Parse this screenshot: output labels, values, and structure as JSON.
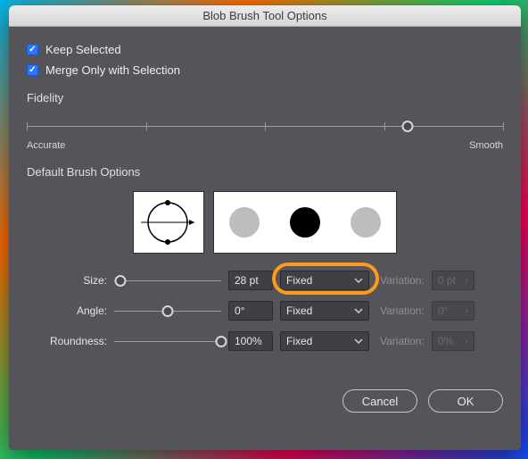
{
  "window": {
    "title": "Blob Brush Tool Options"
  },
  "checkboxes": {
    "keep_selected": {
      "label": "Keep Selected",
      "checked": true
    },
    "merge_selection": {
      "label": "Merge Only with Selection",
      "checked": true
    }
  },
  "fidelity": {
    "title": "Fidelity",
    "axis_left": "Accurate",
    "axis_right": "Smooth",
    "value_pct": 80
  },
  "brush": {
    "title": "Default Brush Options",
    "size": {
      "label": "Size:",
      "value": "28 pt",
      "slider_pct": 6,
      "mode": "Fixed",
      "variation_label": "Variation:",
      "variation": "0 pt"
    },
    "angle": {
      "label": "Angle:",
      "value": "0°",
      "slider_pct": 50,
      "mode": "Fixed",
      "variation_label": "Variation:",
      "variation": "0°"
    },
    "round": {
      "label": "Roundness:",
      "value": "100%",
      "slider_pct": 100,
      "mode": "Fixed",
      "variation_label": "Variation:",
      "variation": "0%"
    }
  },
  "buttons": {
    "cancel": "Cancel",
    "ok": "OK"
  },
  "colors": {
    "highlight": "#ff9a1f",
    "accent_checkbox": "#2a77ff"
  }
}
